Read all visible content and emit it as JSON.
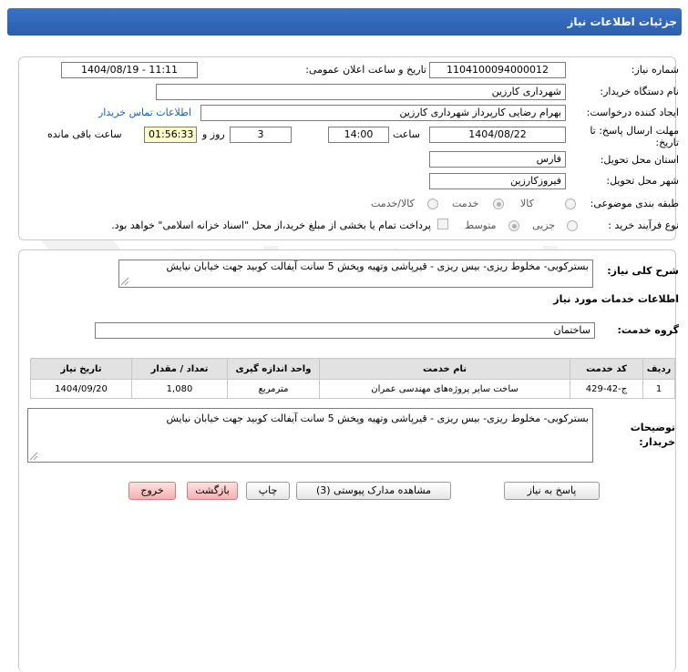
{
  "header": {
    "title": "جزئیات اطلاعات نیاز"
  },
  "info": {
    "need_number_label": "شماره نیاز:",
    "need_number": "1104100094000012",
    "announce_label": "تاریخ و ساعت اعلان عمومی:",
    "announce_value": "1404/08/19 - 11:11",
    "buyer_org_label": "نام دستگاه خریدار:",
    "buyer_org": "شهرداری کارزین",
    "creator_label": "ایجاد کننده درخواست:",
    "creator": "بهرام رضایی کارپرداز شهرداری کارزین",
    "contact_link": "اطلاعات تماس خریدار",
    "deadline_label": "مهلت ارسال پاسخ: تا تاریخ:",
    "deadline_date": "1404/08/22",
    "time_label": "ساعت",
    "deadline_time": "14:00",
    "days_value": "3",
    "days_label": "روز و",
    "remaining_time": "01:56:33",
    "remaining_label": "ساعت باقی مانده",
    "province_label": "استان محل تحویل:",
    "province": "فارس",
    "city_label": "شهر محل تحویل:",
    "city": "فیروزکارزین",
    "category_label": "طبقه بندی موضوعی:",
    "category_options": [
      "کالا",
      "خدمت",
      "کالا/خدمت"
    ],
    "process_label": "نوع فرآیند خرید :",
    "process_options": [
      "جزیی",
      "متوسط"
    ],
    "treasury_note": "پرداخت تمام یا بخشی از مبلغ خرید،از محل \"اسناد خزانه اسلامی\" خواهد بود."
  },
  "summary": {
    "label": "شرح کلی نیاز:",
    "text": "بسترکوبی- مخلوط ریزی- بیس ریزی - قیرپاشی وتهیه وپخش 5 سانت آیفالت کوبید جهت خیابان نیایش"
  },
  "services": {
    "section_title": "اطلاعات خدمات مورد نیاز",
    "group_label": "گروه خدمت:",
    "group_value": "ساختمان",
    "columns": [
      "ردیف",
      "کد خدمت",
      "نام خدمت",
      "واحد اندازه گیری",
      "تعداد / مقدار",
      "تاریخ نیاز"
    ],
    "rows": [
      {
        "row": "1",
        "code": "ج-42-429",
        "name": "ساخت سایر پروژه‌های مهندسی عمران",
        "unit": "مترمربع",
        "qty": "1,080",
        "date": "1404/09/20"
      }
    ]
  },
  "buyer_notes": {
    "label": "توضیحات خریدار:",
    "text": "بسترکوبی- مخلوط ریزی- بیس ریزی - قیرپاشی وتهیه وپخش 5 سانت آیفالت کوبید جهت خیابان نیایش"
  },
  "buttons": {
    "reply": "پاسخ به نیاز",
    "attachments": "مشاهده مدارک پیوستی (3)",
    "print": "چاپ",
    "back": "بازگشت",
    "exit": "خروج"
  },
  "watermark": {
    "text": "AriaTender.net"
  },
  "colors": {
    "header": "#2f66b6",
    "link": "#1560bd",
    "remaining_bg": "#ffffc8",
    "danger_btn": "#f4b0b0"
  }
}
